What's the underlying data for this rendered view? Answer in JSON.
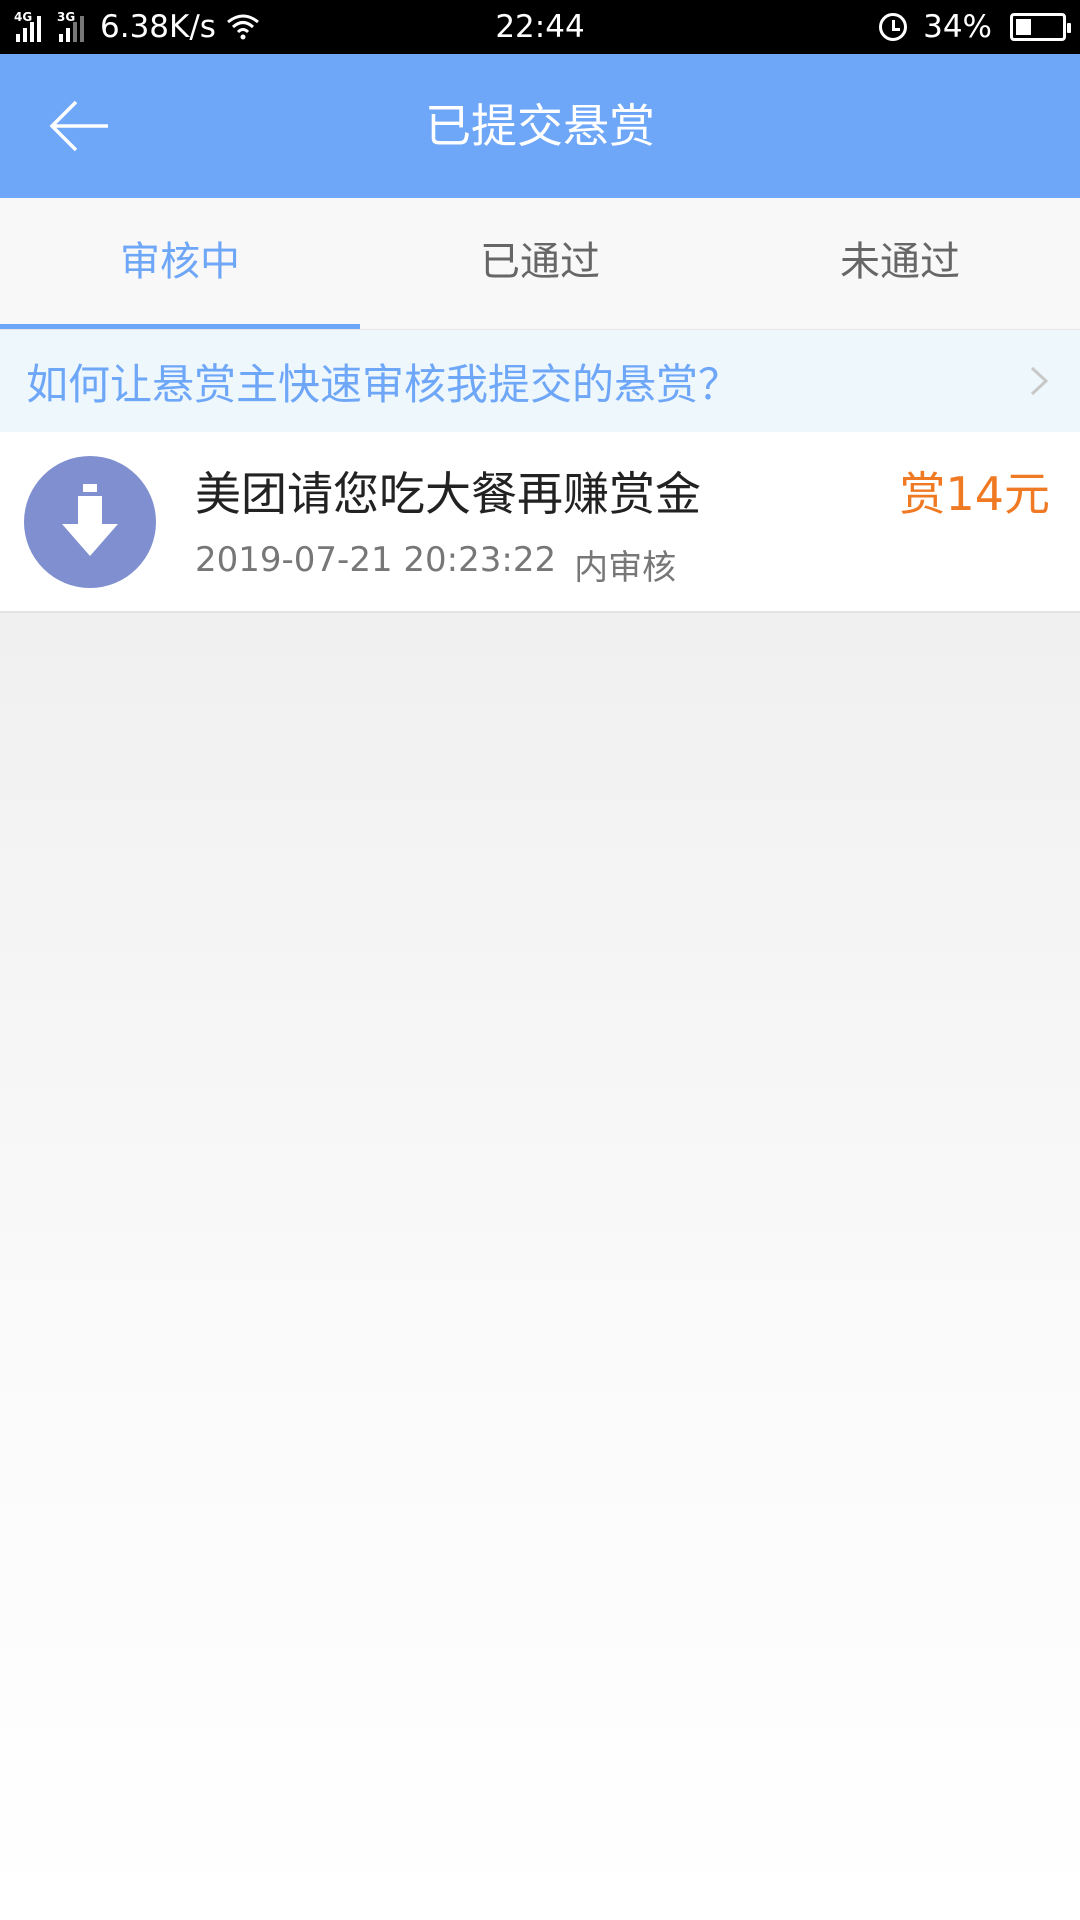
{
  "status_bar": {
    "sig1_label": "4G",
    "sig2_label": "3G",
    "net_speed": "6.38K/s",
    "time": "22:44",
    "battery": "34%",
    "battery_level": 0.34
  },
  "header": {
    "title": "已提交悬赏"
  },
  "tabs": [
    {
      "label": "审核中",
      "active": true
    },
    {
      "label": "已通过",
      "active": false
    },
    {
      "label": "未通过",
      "active": false
    }
  ],
  "tip": {
    "text": "如何让悬赏主快速审核我提交的悬赏？"
  },
  "list": [
    {
      "title": "美团请您吃大餐再赚赏金",
      "reward": "赏14元",
      "datetime": "2019-07-21 20:23:22",
      "status": "内审核"
    }
  ],
  "colors": {
    "accent": "#6ea6f8",
    "reward": "#ef7a23",
    "avatar": "#7f8fd0"
  }
}
